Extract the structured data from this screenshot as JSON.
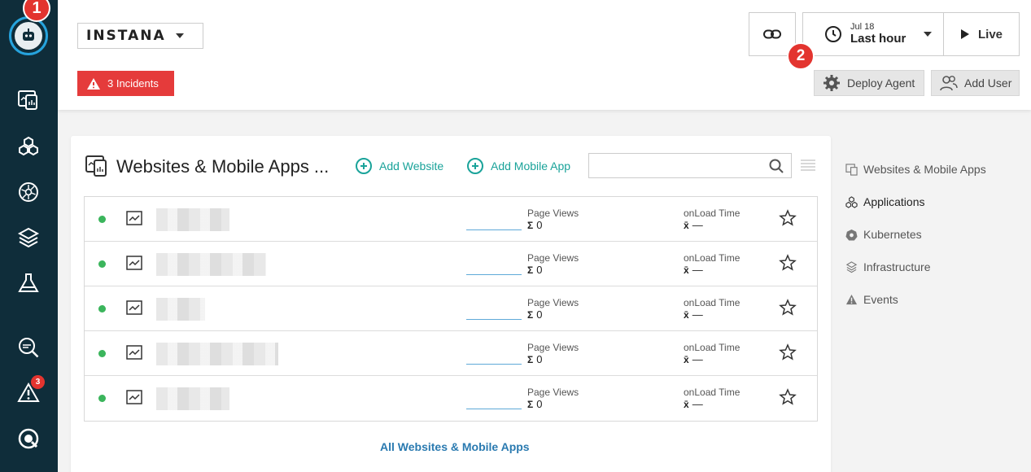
{
  "leftnav": {
    "avatar_icon": "robot-avatar-icon",
    "step_badge": "1",
    "items": [
      {
        "icon": "websites-icon"
      },
      {
        "icon": "applications-icon"
      },
      {
        "icon": "kubernetes-icon"
      },
      {
        "icon": "infrastructure-layers-icon"
      },
      {
        "icon": "flask-icon"
      },
      {
        "icon": "analyze-search-icon"
      },
      {
        "icon": "alert-triangle-icon"
      },
      {
        "icon": "help-icon"
      }
    ],
    "alert_count": "3"
  },
  "header": {
    "logo": "INSTANA",
    "incidents_label": "3 Incidents",
    "time_date": "Jul 18",
    "time_range": "Last hour",
    "live_label": "Live",
    "step_badge": "2",
    "deploy_label": "Deploy Agent",
    "adduser_label": "Add User"
  },
  "main": {
    "title": "Websites & Mobile Apps ...",
    "add_website": "Add Website",
    "add_mobile": "Add Mobile App",
    "search_placeholder": "",
    "rows": [
      {
        "pv_label": "Page Views",
        "pv_sym": "Σ",
        "pv_value": "0",
        "ol_label": "onLoad Time",
        "ol_sym": "x̄",
        "ol_value": "—"
      },
      {
        "pv_label": "Page Views",
        "pv_sym": "Σ",
        "pv_value": "0",
        "ol_label": "onLoad Time",
        "ol_sym": "x̄",
        "ol_value": "—"
      },
      {
        "pv_label": "Page Views",
        "pv_sym": "Σ",
        "pv_value": "0",
        "ol_label": "onLoad Time",
        "ol_sym": "x̄",
        "ol_value": "—"
      },
      {
        "pv_label": "Page Views",
        "pv_sym": "Σ",
        "pv_value": "0",
        "ol_label": "onLoad Time",
        "ol_sym": "x̄",
        "ol_value": "—"
      },
      {
        "pv_label": "Page Views",
        "pv_sym": "Σ",
        "pv_value": "0",
        "ol_label": "onLoad Time",
        "ol_sym": "x̄",
        "ol_value": "—"
      }
    ],
    "all_link": "All Websites & Mobile Apps"
  },
  "rmenu": {
    "items": [
      {
        "label": "Websites & Mobile Apps",
        "icon": "websites-icon"
      },
      {
        "label": "Applications",
        "icon": "applications-icon"
      },
      {
        "label": "Kubernetes",
        "icon": "kubernetes-icon"
      },
      {
        "label": "Infrastructure",
        "icon": "infrastructure-layers-icon"
      },
      {
        "label": "Events",
        "icon": "events-triangle-icon"
      }
    ]
  },
  "colors": {
    "nav_bg": "#0f2d3a",
    "accent_teal": "#1aa39a",
    "incident_red": "#e53b3b",
    "status_green": "#3bb55c",
    "link_blue": "#2a7ab0"
  }
}
